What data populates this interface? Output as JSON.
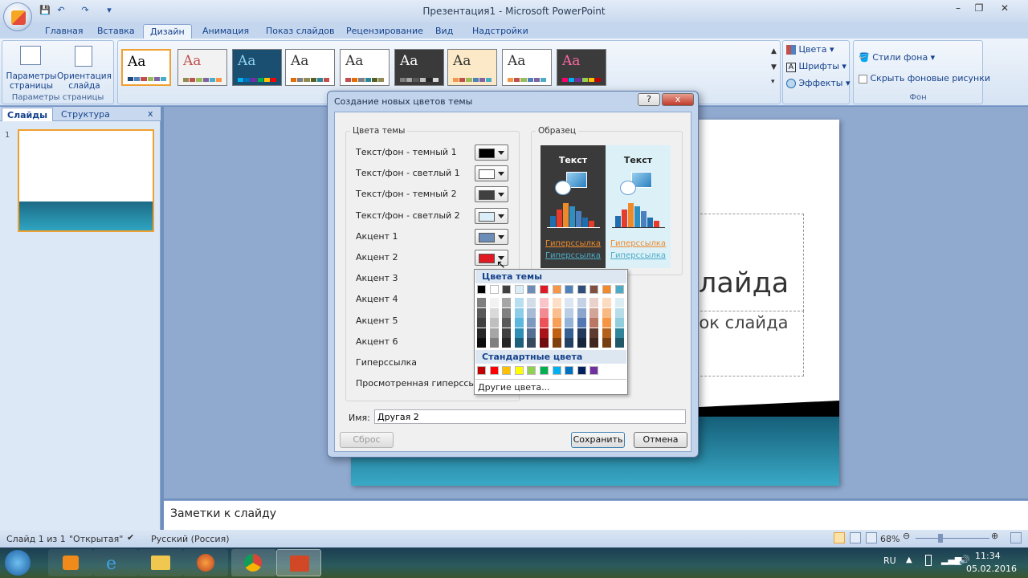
{
  "window": {
    "title": "Презентация1 - Microsoft PowerPoint"
  },
  "tabs": [
    {
      "label": "Главная"
    },
    {
      "label": "Вставка"
    },
    {
      "label": "Дизайн"
    },
    {
      "label": "Анимация"
    },
    {
      "label": "Показ слайдов"
    },
    {
      "label": "Рецензирование"
    },
    {
      "label": "Вид"
    },
    {
      "label": "Надстройки"
    }
  ],
  "ribbon": {
    "page_setup": {
      "params_label": "Параметры страницы",
      "orient_label": "Ориентация слайда",
      "group_label": "Параметры страницы"
    },
    "themes": [
      {
        "colors": [
          "#1f497d",
          "#4f81bd",
          "#c0504d",
          "#9bbb59",
          "#8064a2",
          "#4bacc6"
        ],
        "bg": "#ffffff",
        "fg": "#000000"
      },
      {
        "colors": [
          "#938953",
          "#c0504d",
          "#9bbb59",
          "#8064a2",
          "#4bacc6",
          "#f79646"
        ],
        "bg": "#f2f2f2",
        "fg": "#c0504d"
      },
      {
        "colors": [
          "#00b0f0",
          "#0070c0",
          "#7030a0",
          "#00b050",
          "#ffc000",
          "#ff0000"
        ],
        "bg": "#1b4f72",
        "fg": "#8fd3f0"
      },
      {
        "colors": [
          "#e36c09",
          "#7f7f7f",
          "#948a54",
          "#4f6228",
          "#31859b",
          "#c0504d"
        ],
        "bg": "#ffffff",
        "fg": "#333333"
      },
      {
        "colors": [
          "#c0504d",
          "#e36c09",
          "#7f7f7f",
          "#31859b",
          "#4f6228",
          "#948a54"
        ],
        "bg": "#ffffff",
        "fg": "#333333"
      },
      {
        "colors": [
          "#7f7f7f",
          "#a5a5a5",
          "#595959",
          "#bfbfbf",
          "#262626",
          "#d9d9d9"
        ],
        "bg": "#3a3a3a",
        "fg": "#ffffff"
      },
      {
        "colors": [
          "#f79646",
          "#c0504d",
          "#9bbb59",
          "#4f81bd",
          "#8064a2",
          "#4bacc6"
        ],
        "bg": "#fbe9c8",
        "fg": "#333333"
      },
      {
        "colors": [
          "#f79646",
          "#c0504d",
          "#9bbb59",
          "#4f81bd",
          "#8064a2",
          "#4bacc6"
        ],
        "bg": "#ffffff",
        "fg": "#333333"
      },
      {
        "colors": [
          "#ff0066",
          "#00b0f0",
          "#7030a0",
          "#92d050",
          "#ffc000",
          "#c00000"
        ],
        "bg": "#3b3b3b",
        "fg": "#ff66a3"
      }
    ],
    "theme_glyph": "Aa",
    "colors_label": "Цвета",
    "fonts_label": "Шрифты",
    "effects_label": "Эффекты",
    "bg_styles_label": "Стили фона",
    "hide_bg_label": "Скрыть фоновые рисунки",
    "bg_group_label": "Фон"
  },
  "leftpane": {
    "tab_slides": "Слайды",
    "tab_outline": "Структура",
    "close": "x",
    "slide_number": "1"
  },
  "slide": {
    "title_fragment": "лайда",
    "subtitle_fragment": "вок слайда"
  },
  "notes": {
    "placeholder": "Заметки к слайду"
  },
  "dialog": {
    "title": "Создание новых цветов темы",
    "help": "?",
    "close": "x",
    "theme_colors_legend": "Цвета темы",
    "sample_legend": "Образец",
    "rows": [
      {
        "label": "Текст/фон - темный 1",
        "color": "#000000"
      },
      {
        "label": "Текст/фон - светлый 1",
        "color": "#ffffff"
      },
      {
        "label": "Текст/фон - темный 2",
        "color": "#404040"
      },
      {
        "label": "Текст/фон - светлый 2",
        "color": "#dbeef7"
      },
      {
        "label": "Акцент 1",
        "color": "#6b8db8"
      },
      {
        "label": "Акцент 2",
        "color": "#e01a23"
      },
      {
        "label": "Акцент 3",
        "color": ""
      },
      {
        "label": "Акцент 4",
        "color": ""
      },
      {
        "label": "Акцент 5",
        "color": ""
      },
      {
        "label": "Акцент 6",
        "color": ""
      },
      {
        "label": "Гиперссылка",
        "color": ""
      },
      {
        "label": "Просмотренная гиперссылка",
        "color": ""
      }
    ],
    "sample": {
      "text_label": "Текст",
      "hyperlink": "Гиперссылка",
      "dark_bg": "#3a3a3a",
      "light_bg": "#dcf0f8",
      "bar_colors": [
        "#1f6fb0",
        "#e63c2c",
        "#ee8a2a",
        "#2f8ec2",
        "#4a80c0"
      ]
    },
    "name_label": "Имя:",
    "name_value": "Другая 2",
    "reset_label": "Сброс",
    "save_label": "Сохранить",
    "cancel_label": "Отмена"
  },
  "dropdown": {
    "theme_header": "Цвета темы",
    "standard_header": "Стандартные цвета",
    "more_label": "Другие цвета...",
    "theme_top": [
      "#000000",
      "#ffffff",
      "#404040",
      "#dbeef7",
      "#6b8db8",
      "#e01a23",
      "#f79646",
      "#4f81bd",
      "#2f4c7a",
      "#7f4f3f",
      "#f08a2a",
      "#4bacc6"
    ],
    "theme_shades": [
      [
        "#7f7f7f",
        "#595959",
        "#404040",
        "#262626",
        "#0d0d0d"
      ],
      [
        "#f2f2f2",
        "#d9d9d9",
        "#bfbfbf",
        "#a6a6a6",
        "#808080"
      ],
      [
        "#a6a6a6",
        "#808080",
        "#595959",
        "#404040",
        "#262626"
      ],
      [
        "#b7dff0",
        "#8ccde8",
        "#5cb9dd",
        "#2d8fb5",
        "#1c607a"
      ],
      [
        "#d3dde9",
        "#a8bbd4",
        "#7d99be",
        "#546f91",
        "#37495f"
      ],
      [
        "#f9c5c8",
        "#f38c92",
        "#ee5259",
        "#a81218",
        "#700c10"
      ],
      [
        "#fcdfc6",
        "#fabf8f",
        "#f8a058",
        "#c06010",
        "#80400b"
      ],
      [
        "#dce6f2",
        "#b9cde5",
        "#95b3d7",
        "#366092",
        "#244062"
      ],
      [
        "#c5d2e6",
        "#8ca5cc",
        "#5277b2",
        "#22385a",
        "#16253c"
      ],
      [
        "#e8d2cb",
        "#d1a597",
        "#ba7864",
        "#5f3a2f",
        "#3f271f"
      ],
      [
        "#fcdcc0",
        "#f9b982",
        "#f69644",
        "#b3601a",
        "#773f11"
      ],
      [
        "#dbeef3",
        "#b7dde8",
        "#92cddc",
        "#31859b",
        "#205867"
      ]
    ],
    "standard": [
      "#c00000",
      "#ff0000",
      "#ffc000",
      "#ffff00",
      "#92d050",
      "#00b050",
      "#00b0f0",
      "#0070c0",
      "#002060",
      "#7030a0"
    ]
  },
  "status": {
    "slide_info": "Слайд 1 из 1",
    "theme": "\"Открытая\"",
    "language": "Русский (Россия)",
    "zoom": "68%"
  },
  "taskbar": {
    "lang": "RU",
    "time": "11:34",
    "date": "05.02.2016"
  }
}
